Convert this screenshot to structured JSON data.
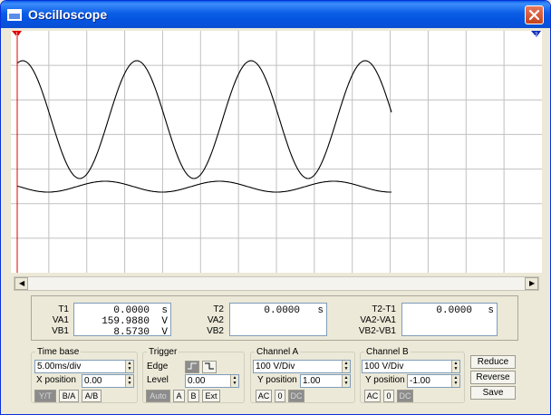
{
  "window": {
    "title": "Oscilloscope"
  },
  "cursors": {
    "t1": "1",
    "t2": "2"
  },
  "readout": {
    "col1": {
      "labels": [
        "T1",
        "VA1",
        "VB1"
      ],
      "values": [
        [
          "0.0000",
          "s"
        ],
        [
          "159.9880",
          "V"
        ],
        [
          "8.5730",
          "V"
        ]
      ]
    },
    "col2": {
      "labels": [
        "T2",
        "VA2",
        "VB2"
      ],
      "values": [
        [
          "0.0000",
          "s"
        ]
      ]
    },
    "col3": {
      "labels": [
        "T2-T1",
        "VA2-VA1",
        "VB2-VB1"
      ],
      "values": [
        [
          "0.0000",
          "s"
        ]
      ]
    }
  },
  "timebase": {
    "legend": "Time base",
    "scale": "5.00ms/div",
    "xpos_label": "X position",
    "xpos": "0.00",
    "modes": [
      "Y/T",
      "B/A",
      "A/B"
    ],
    "active_mode": "Y/T"
  },
  "trigger": {
    "legend": "Trigger",
    "edge_label": "Edge",
    "level_label": "Level",
    "level": "0.00",
    "sources": [
      "Auto",
      "A",
      "B",
      "Ext"
    ],
    "active_source": "Auto"
  },
  "channel_a": {
    "legend": "Channel A",
    "scale": "100 V/Div",
    "ypos_label": "Y position",
    "ypos": "1.00",
    "coupling": [
      "AC",
      "0",
      "DC"
    ],
    "active_coupling": "DC"
  },
  "channel_b": {
    "legend": "Channel B",
    "scale": "100 V/Div",
    "ypos_label": "Y position",
    "ypos": "-1.00",
    "coupling": [
      "AC",
      "0",
      "DC"
    ],
    "active_coupling": "DC"
  },
  "actions": {
    "reduce": "Reduce",
    "reverse": "Reverse",
    "save": "Save"
  },
  "colors": {
    "grid": "#c0c0c0",
    "trace": "#000000",
    "cursor1": "#e00000",
    "cursor2": "#1030c0",
    "titlebar": "#0c5ee6"
  }
}
